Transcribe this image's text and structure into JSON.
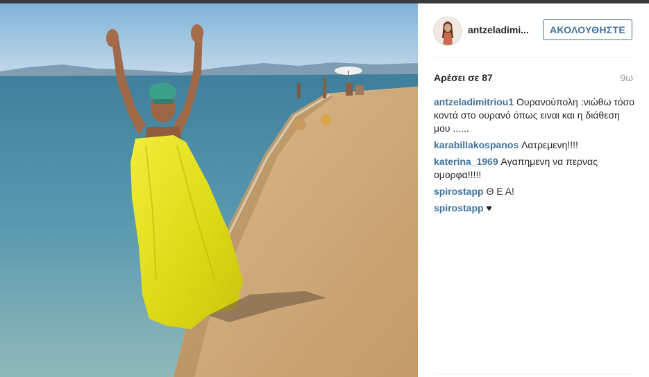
{
  "post": {
    "username": "antzeladimi...",
    "follow_label": "ΑΚΟΛΟΥΘΗΣΤΕ",
    "likes_text": "Αρέσει σε 87",
    "time_ago": "9ω"
  },
  "comments": [
    {
      "user": "antzeladimitriou1",
      "text": "Ουρανούπολη :νιώθω τόσο κοντά στο ουρανό όπως ειναι και η διάθεση μου ......"
    },
    {
      "user": "karabillakospanos",
      "text": "Λατρεμενη!!!!"
    },
    {
      "user": "katerina_1969",
      "text": "Αγαπημενη να περνας ομορφα!!!!!"
    },
    {
      "user": "spirostapp",
      "text": "Θ Ε Α!"
    },
    {
      "user": "spirostapp",
      "text": "♥"
    }
  ],
  "colors": {
    "link": "#3f729b",
    "dress": "#e8e41a",
    "sea": "#4a8fa6",
    "sand": "#cfa978",
    "sky": "#9cc6e0"
  },
  "icons": {
    "avatar": "profile-photo"
  }
}
